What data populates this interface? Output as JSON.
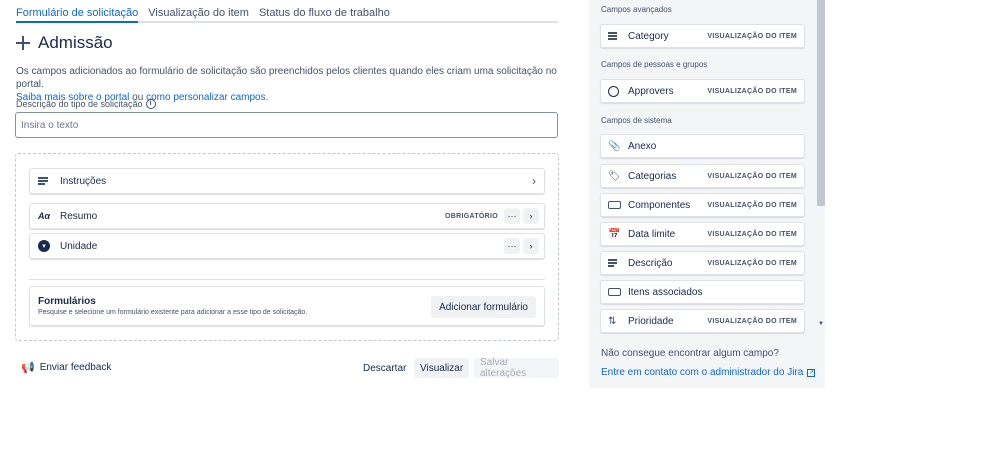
{
  "tabs": [
    {
      "label": "Formulário de solicitação",
      "active": true
    },
    {
      "label": "Visualização do item",
      "active": false
    },
    {
      "label": "Status do fluxo de trabalho",
      "active": false
    }
  ],
  "header": {
    "title": "Admissão"
  },
  "description": {
    "text": "Os campos adicionados ao formulário de solicitação são preenchidos pelos clientes quando eles criam uma solicitação no portal.",
    "link1": "Saiba mais sobre o portal",
    "connector": " ou ",
    "link2": "como personalizar campos."
  },
  "request_type": {
    "label": "Descrição do tipo de solicitação",
    "placeholder": "Insira o texto",
    "value": ""
  },
  "fields": [
    {
      "label": "Instruções",
      "icon": "lines-icon"
    },
    {
      "label": "Resumo",
      "icon": "text-icon",
      "badge": "OBRIGATÓRIO"
    },
    {
      "label": "Unidade",
      "icon": "dropdown-icon"
    }
  ],
  "forms": {
    "title": "Formulários",
    "subtitle": "Pesquise e selecione um formulário existente para adicionar a esse tipo de solicitação.",
    "button": "Adicionar formulário"
  },
  "footer": {
    "feedback": "Enviar feedback",
    "discard": "Descartar",
    "preview": "Visualizar",
    "save": "Salvar alterações"
  },
  "panel": {
    "sections": [
      {
        "title": "Campos avançados",
        "items": [
          {
            "label": "Category",
            "icon": "lines-icon",
            "badge": "VISUALIZAÇÃO DO ITEM"
          }
        ]
      },
      {
        "title": "Campos de pessoas e grupos",
        "items": [
          {
            "label": "Approvers",
            "icon": "user-icon",
            "badge": "VISUALIZAÇÃO DO ITEM"
          }
        ]
      },
      {
        "title": "Campos de sistema",
        "items": [
          {
            "label": "Anexo",
            "icon": "paperclip-icon",
            "badge": ""
          },
          {
            "label": "Categorias",
            "icon": "tag-icon",
            "badge": "VISUALIZAÇÃO DO ITEM"
          },
          {
            "label": "Componentes",
            "icon": "component-icon",
            "badge": "VISUALIZAÇÃO DO ITEM"
          },
          {
            "label": "Data limite",
            "icon": "calendar-icon",
            "badge": "VISUALIZAÇÃO DO ITEM"
          },
          {
            "label": "Descrição",
            "icon": "lines-icon",
            "badge": "VISUALIZAÇÃO DO ITEM"
          },
          {
            "label": "Itens associados",
            "icon": "component-icon",
            "badge": ""
          },
          {
            "label": "Prioridade",
            "icon": "priority-icon",
            "badge": "VISUALIZAÇÃO DO ITEM"
          }
        ]
      }
    ],
    "cant_find": "Não consegue encontrar algum campo?",
    "contact": "Entre em contato com o administrador do Jira"
  }
}
